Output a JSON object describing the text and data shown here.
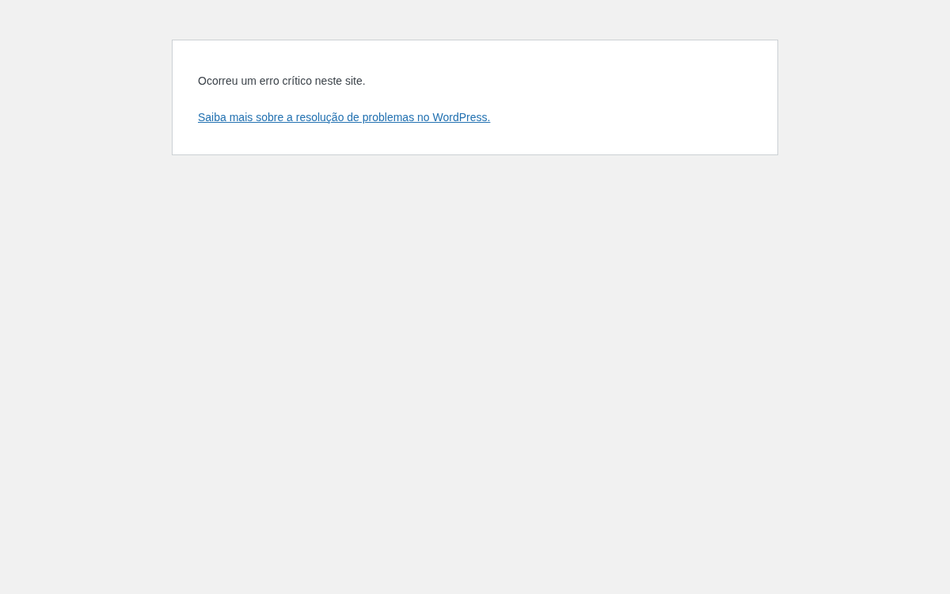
{
  "message": "Ocorreu um erro crítico neste site.",
  "link": "Saiba mais sobre a resolução de problemas no WordPress."
}
